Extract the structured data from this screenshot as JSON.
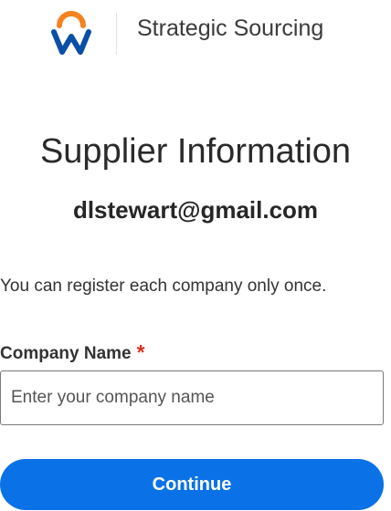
{
  "header": {
    "logo_icon": "workday-logo-icon",
    "title": "Strategic Sourcing"
  },
  "page": {
    "title": "Supplier Information",
    "email": "dlstewart@gmail.com",
    "notice": "You can register each company only once."
  },
  "form": {
    "company_name": {
      "label": "Company Name",
      "required_marker": "*",
      "value": "",
      "placeholder": "Enter your company name"
    },
    "continue_label": "Continue"
  },
  "colors": {
    "logo_orange": "#f6821f",
    "logo_blue": "#0a4fa6",
    "required": "#d9301f",
    "button": "#0a72e6"
  }
}
